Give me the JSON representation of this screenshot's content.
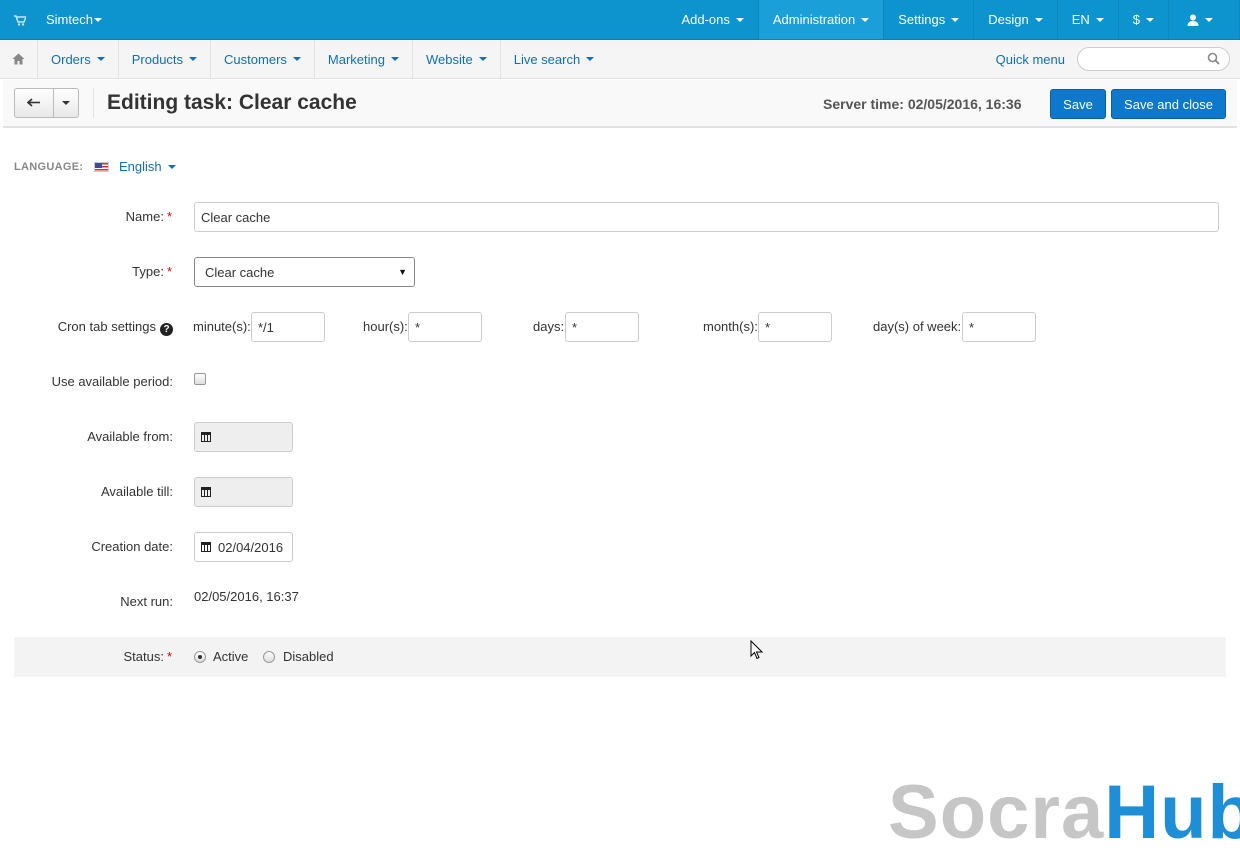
{
  "topbar": {
    "store_name": "Simtech",
    "menu": [
      {
        "label": "Add-ons"
      },
      {
        "label": "Administration"
      },
      {
        "label": "Settings"
      },
      {
        "label": "Design"
      },
      {
        "label": "EN"
      },
      {
        "label": "$"
      }
    ],
    "icons": {
      "cart": "cart-icon",
      "user": "user-icon"
    }
  },
  "nav": {
    "items": [
      {
        "label": "Orders"
      },
      {
        "label": "Products"
      },
      {
        "label": "Customers"
      },
      {
        "label": "Marketing"
      },
      {
        "label": "Website"
      },
      {
        "label": "Live search"
      }
    ],
    "quick_menu": "Quick menu",
    "search_placeholder": ""
  },
  "actionbar": {
    "title": "Editing task: Clear cache",
    "server_time": "Server time: 02/05/2016, 16:36",
    "save_label": "Save",
    "save_close_label": "Save and close"
  },
  "language": {
    "label": "LANGUAGE:",
    "value": "English"
  },
  "form": {
    "name_label": "Name:",
    "name_value": "Clear cache",
    "type_label": "Type:",
    "type_value": "Clear cache",
    "cron_label": "Cron tab settings",
    "cron": {
      "minute_label": "minute(s):",
      "minute_value": "*/1",
      "hour_label": "hour(s):",
      "hour_value": "*",
      "days_label": "days:",
      "days_value": "*",
      "month_label": "month(s):",
      "month_value": "*",
      "dow_label": "day(s) of week:",
      "dow_value": "*"
    },
    "use_period_label": "Use available period:",
    "use_period_checked": false,
    "available_from_label": "Available from:",
    "available_from_value": "",
    "available_till_label": "Available till:",
    "available_till_value": "",
    "creation_date_label": "Creation date:",
    "creation_date_value": "02/04/2016",
    "next_run_label": "Next run:",
    "next_run_value": "02/05/2016, 16:37",
    "status_label": "Status:",
    "status_options": [
      {
        "label": "Active",
        "checked": true
      },
      {
        "label": "Disabled",
        "checked": false
      }
    ]
  },
  "watermark": {
    "part1": "Socra",
    "part2": "Hub"
  },
  "colors": {
    "topbar": "#0d94cf",
    "primary_button": "#0e78cc",
    "link": "#0e70b8",
    "required": "#dd0000"
  }
}
